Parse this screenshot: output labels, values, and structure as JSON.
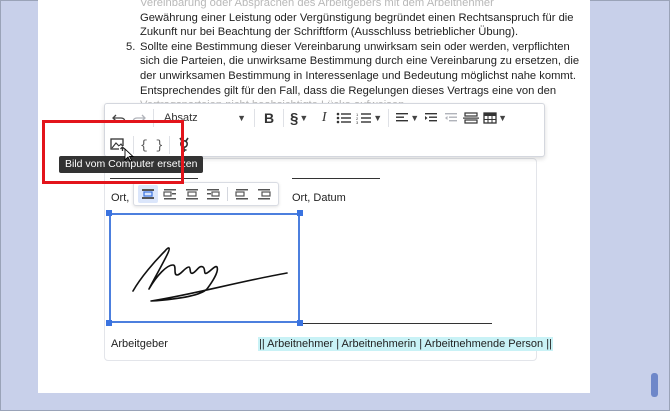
{
  "document": {
    "list_partial_line": "Vereinbarung oder Absprachen des Arbeitgebers mit dem Arbeitnehmer",
    "list_lines_before": [
      "Gewährung einer Leistung oder Vergünstigung begründet einen Rechtsanspruch für die",
      "Zukunft nur bei Beachtung der Schriftform (Ausschluss betrieblicher Übung)."
    ],
    "item5_number": "5.",
    "item5_lines": [
      "Sollte eine Bestimmung dieser Vereinbarung unwirksam sein oder werden, verpflichten",
      "sich die Parteien, die unwirksame Bestimmung durch eine Vereinbarung zu ersetzen, die",
      "der unwirksamen Bestimmung in Interessenlage und Bedeutung möglichst nahe kommt.",
      "Entsprechendes gilt für den Fall, dass die Regelungen dieses Vertrags eine von den",
      "Vertragsparteien nicht beabsichtigte Lücke aufweisen."
    ]
  },
  "signature_block": {
    "left_place_label": "Ort, D",
    "right_place_label": "Ort, Datum",
    "employer_label": "Arbeitgeber",
    "employee_label": "|| Arbeitnehmer | Arbeitnehmerin | Arbeitnehmende Person ||",
    "highlight_color": "#c9f2f6"
  },
  "toolbar": {
    "undo_icon": "undo-icon",
    "redo_icon": "redo-icon",
    "paragraph_style": "Absatz",
    "bold_label": "B",
    "section_label": "§",
    "italic_label": "I",
    "replace_image_tooltip": "Bild vom Computer ersetzen",
    "variables_label": "{ }"
  },
  "colors": {
    "accent": "#3a73e0",
    "annotation_red": "#e3141b",
    "page_background": "#c8d0ea"
  }
}
